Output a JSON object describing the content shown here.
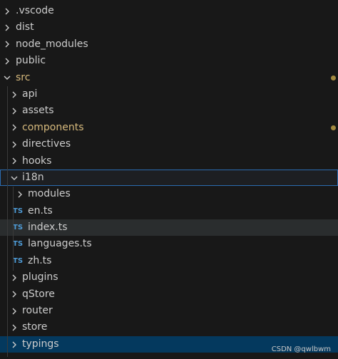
{
  "explorer": {
    "items": [
      {
        "label": ".vscode",
        "kind": "folder",
        "open": false,
        "depth": 0
      },
      {
        "label": "dist",
        "kind": "folder",
        "open": false,
        "depth": 0
      },
      {
        "label": "node_modules",
        "kind": "folder",
        "open": false,
        "depth": 0
      },
      {
        "label": "public",
        "kind": "folder",
        "open": false,
        "depth": 0
      },
      {
        "label": "src",
        "kind": "folder",
        "open": true,
        "depth": 0,
        "modified": true
      },
      {
        "label": "api",
        "kind": "folder",
        "open": false,
        "depth": 1
      },
      {
        "label": "assets",
        "kind": "folder",
        "open": false,
        "depth": 1
      },
      {
        "label": "components",
        "kind": "folder",
        "open": false,
        "depth": 1,
        "modified": true
      },
      {
        "label": "directives",
        "kind": "folder",
        "open": false,
        "depth": 1
      },
      {
        "label": "hooks",
        "kind": "folder",
        "open": false,
        "depth": 1
      },
      {
        "label": "i18n",
        "kind": "folder",
        "open": true,
        "depth": 1
      },
      {
        "label": "modules",
        "kind": "folder",
        "open": false,
        "depth": 2
      },
      {
        "label": "en.ts",
        "kind": "ts",
        "depth": 2
      },
      {
        "label": "index.ts",
        "kind": "ts",
        "depth": 2
      },
      {
        "label": "languages.ts",
        "kind": "ts",
        "depth": 2
      },
      {
        "label": "zh.ts",
        "kind": "ts",
        "depth": 2
      },
      {
        "label": "plugins",
        "kind": "folder",
        "open": false,
        "depth": 1
      },
      {
        "label": "qStore",
        "kind": "folder",
        "open": false,
        "depth": 1
      },
      {
        "label": "router",
        "kind": "folder",
        "open": false,
        "depth": 1
      },
      {
        "label": "store",
        "kind": "folder",
        "open": false,
        "depth": 1
      },
      {
        "label": "typings",
        "kind": "folder",
        "open": false,
        "depth": 1
      }
    ],
    "ts_badge": "TS"
  },
  "watermark": "CSDN @qwlbwm",
  "colors": {
    "background": "#181818",
    "text": "#cccccc",
    "modified": "#d7ba7d",
    "modified_dot": "#a38a40",
    "ts_badge": "#4e9bd6",
    "selection_outline": "#2b6cb0",
    "hover_row": "#2a2d2e",
    "focus_row": "#04395e"
  }
}
